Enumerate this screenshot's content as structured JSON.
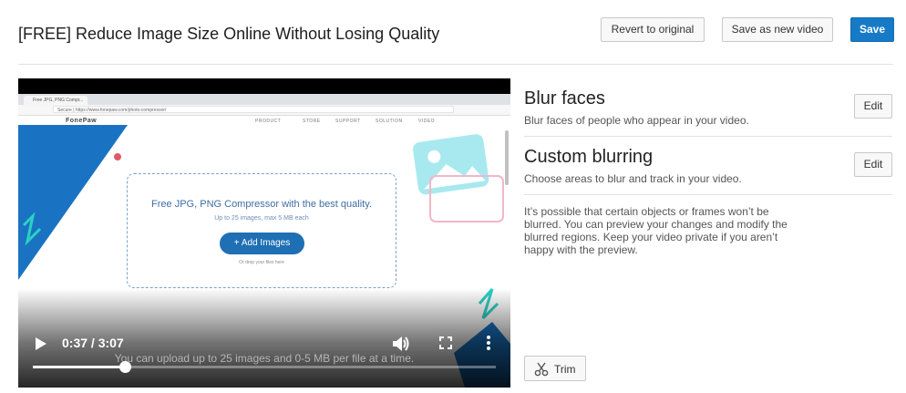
{
  "header": {
    "title": "[FREE] Reduce Image Size Online Without Losing Quality",
    "revert_label": "Revert to original",
    "save_as_new_label": "Save as new video",
    "save_label": "Save"
  },
  "player": {
    "time_display": "0:37 / 3:07",
    "progress": 0.198,
    "caption": "You can upload up to 25 images and 0-5 MB per file at a time.",
    "icons": [
      "play-icon",
      "volume-icon",
      "fullscreen-icon",
      "more-vert-icon"
    ]
  },
  "video_frame": {
    "browser_tab": "Free JPG, PNG Compr...",
    "url": "Secure | https://www.fonepaw.com/photo-compressor/",
    "brand": "FonePaw",
    "nav": [
      "PRODUCT",
      "STORE",
      "SUPPORT",
      "SOLUTION",
      "VIDEO"
    ],
    "dropzone_title": "Free JPG, PNG Compressor with the best quality.",
    "dropzone_sub": "Up to 25 images, max 5 MB each",
    "add_images_label": "+ Add Images",
    "drop_hint": "Or drop your files here"
  },
  "blur_faces": {
    "title": "Blur faces",
    "description": "Blur faces of people who appear in your video.",
    "edit_label": "Edit"
  },
  "custom_blurring": {
    "title": "Custom blurring",
    "description": "Choose areas to blur and track in your video.",
    "edit_label": "Edit"
  },
  "note": "It’s possible that certain objects or frames won’t be blurred. You can preview your changes and modify the blurred regions. Keep your video private if you aren’t happy with the preview.",
  "trim": {
    "label": "Trim",
    "icon": "scissors-icon"
  },
  "colors": {
    "accent": "#167ac6",
    "dropzone_button": "#1f6fb4"
  }
}
